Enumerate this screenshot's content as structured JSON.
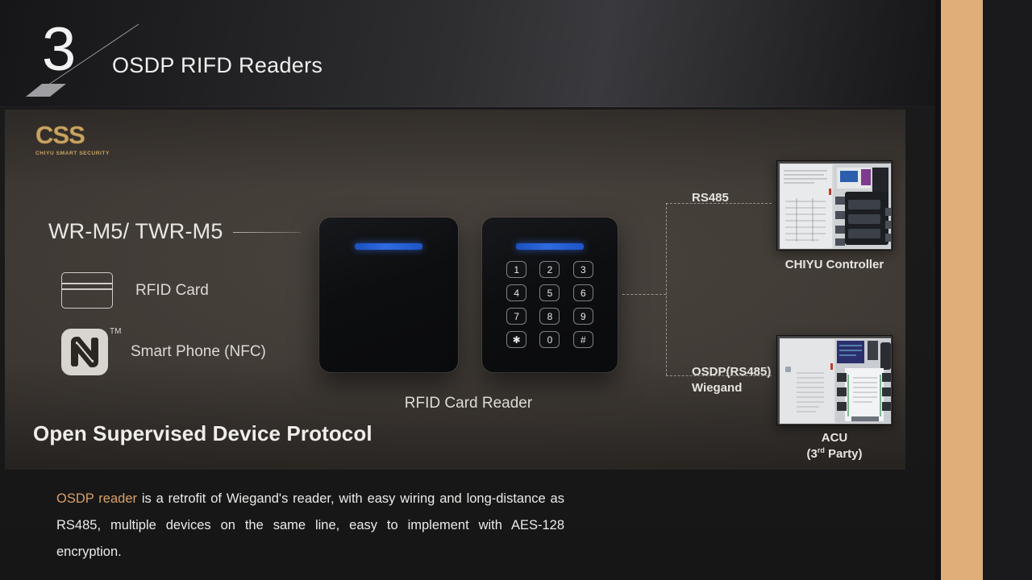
{
  "slide": {
    "number": "3",
    "title": "OSDP RIFD Readers"
  },
  "brand": {
    "mark": "CSS",
    "subtitle": "CHIYU SMART SECURITY"
  },
  "panel": {
    "model_name": "WR-M5/ TWR-M5",
    "headline": "Open Supervised Device Protocol",
    "device_caption": "RFID Card Reader",
    "features": [
      {
        "icon": "rfid-card-icon",
        "label": "RFID Card"
      },
      {
        "icon": "nfc-icon",
        "label": "Smart Phone (NFC)",
        "trademark": "TM"
      }
    ]
  },
  "keypad": {
    "keys": [
      "1",
      "2",
      "3",
      "4",
      "5",
      "6",
      "7",
      "8",
      "9",
      "✱",
      "0",
      "#"
    ]
  },
  "connectors": {
    "top_label": "RS485",
    "bottom_label_line1": "OSDP(RS485)",
    "bottom_label_line2": "Wiegand"
  },
  "photos": [
    {
      "name": "chiyu-controller",
      "label": "CHIYU Controller"
    },
    {
      "name": "acu-third-party",
      "label_line1": "ACU",
      "label_line2_pre": "(3",
      "label_line2_sup": "rd",
      "label_line2_post": " Party)"
    }
  ],
  "caption": {
    "highlight": "OSDP reader",
    "rest": " is a retrofit of Wiegand's reader, with easy wiring and long-distance as RS485, multiple devices on the same line, easy to implement with AES-128 encryption."
  },
  "colors": {
    "accent_tan": "#e0ae78",
    "brand_gold": "#c9a464",
    "caption_highlight": "#d9a066",
    "led_blue": "#2f6ae0"
  }
}
